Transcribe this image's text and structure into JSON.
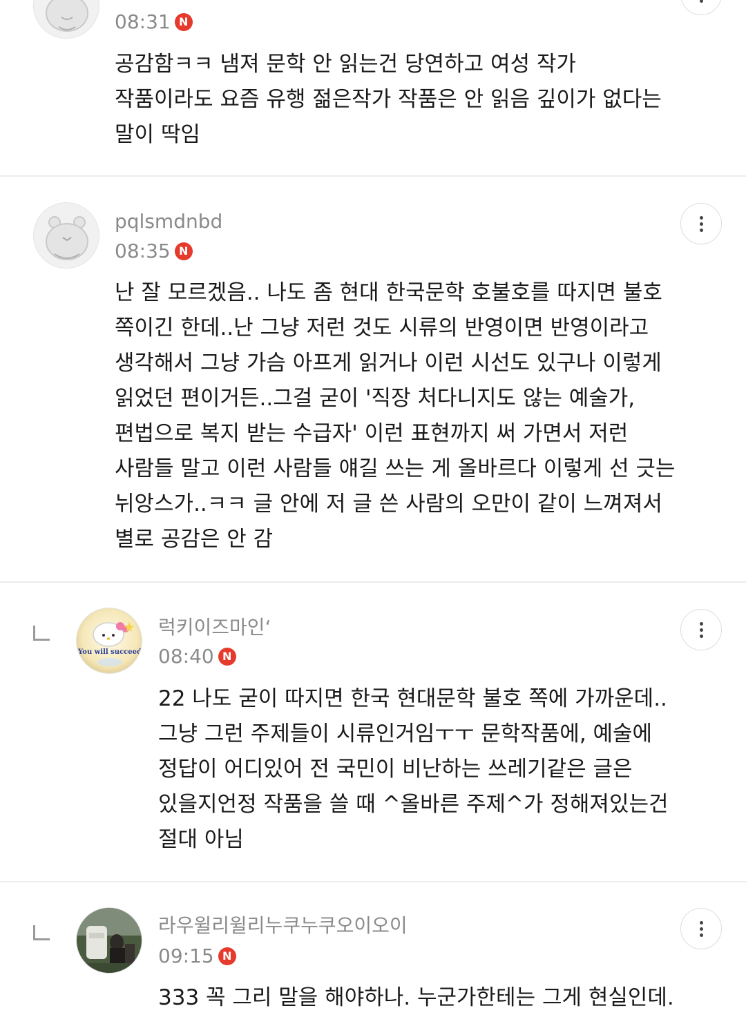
{
  "comments": [
    {
      "username": "",
      "time": "08:31",
      "badge": "N",
      "lines": [
        "공감함ㅋㅋ 냄져 문학 안 읽는건 당연하고 여성 작가",
        "작품이라도 요즘 유행 젊은작가 작품은 안 읽음 깊이가 없다는",
        "말이 딱임"
      ],
      "avatar_icon": "bear-avatar-icon"
    },
    {
      "username": "pqlsmdnbd",
      "time": "08:35",
      "badge": "N",
      "lines": [
        "난 잘 모르겠음.. 나도 좀 현대 한국문학 호불호를 따지면 불호",
        "쪽이긴 한데..난 그냥 저런 것도 시류의 반영이면 반영이라고",
        "생각해서 그냥 가슴 아프게 읽거나 이런 시선도 있구나 이렇게",
        "읽었던 편이거든..그걸 굳이 '직장 처다니지도 않는 예술가,",
        "편법으로 복지 받는 수급자' 이런 표현까지 써 가면서 저런",
        "사람들 말고 이런 사람들 얘길 쓰는 게 올바르다 이렇게 선 긋는",
        "뉘앙스가..ㅋㅋ 글 안에 저 글 쓴 사람의 오만이 같이 느껴져서",
        "별로 공감은 안 감"
      ],
      "avatar_icon": "bear-avatar-icon"
    },
    {
      "username": "럭키이즈마인‘",
      "time": "08:40",
      "badge": "N",
      "avatar_text": "You will succeed",
      "lines": [
        "22 나도 굳이 따지면 한국 현대문학 불호 쪽에 가까운데..",
        "그냥 그런 주제들이 시류인거임ㅜㅜ 문학작품에, 예술에",
        "정답이 어디있어 전 국민이 비난하는 쓰레기같은 글은",
        "있을지언정 작품을 쓸 때 ^올바른 주제^가 정해져있는건",
        "절대 아님"
      ],
      "avatar_icon": "hello-kitty-avatar-icon"
    },
    {
      "username": "라우윌리윌리누쿠누쿠오이오이",
      "time": "09:15",
      "badge": "N",
      "lines": [
        "333 꼭 그리 말을 해야하나. 누군가한테는 그게 현실인데."
      ],
      "avatar_icon": "photo-avatar-icon"
    }
  ],
  "icons": {
    "more": "more-vertical-icon",
    "reply": "reply-arrow-icon"
  },
  "colors": {
    "badge": "#e53a2c",
    "meta_text": "#8a8a8a",
    "body_text": "#1a1a1a",
    "divider": "#ececec"
  }
}
